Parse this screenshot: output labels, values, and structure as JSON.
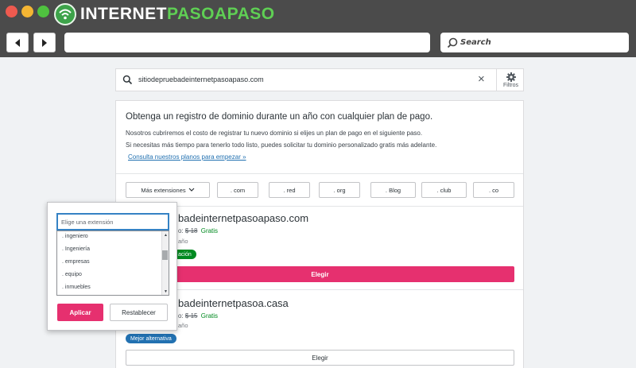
{
  "brand": {
    "logo_white": "INTERNET",
    "logo_green": "PASOAPASO"
  },
  "browser": {
    "search_placeholder": "Search",
    "colors": {
      "chrome": "#4b4b4b",
      "close": "#ee5a4f",
      "minimize": "#f4b533",
      "maximize": "#4fc23f"
    }
  },
  "search": {
    "query": "sitiodepruebadeinternetpasoapaso.com",
    "filters_label": "Filtros"
  },
  "promo": {
    "title": "Obtenga un registro de dominio durante un año con cualquier plan de pago.",
    "line1": "Nosotros cubriremos el costo de registrar tu nuevo dominio si elijes un plan de pago en el siguiente paso.",
    "line2": "Si necesitas más tiempo para tenerlo todo listo, puedes solicitar tu dominio personalizado gratis más adelante.",
    "link": "Consulta nuestros planos para empezar »"
  },
  "extensions": {
    "more_label": "Más extensiones",
    "tlds": [
      ". com",
      ". red",
      ". org",
      ". Blog",
      ". club",
      ". co"
    ]
  },
  "results": [
    {
      "name": "sitiodepruebadeinternetpasoapaso.com",
      "visible_name": "badeinternetpasoapaso.com",
      "price_prefix": "o:",
      "old_price": "$ 18",
      "free": "Gratis",
      "term": "año",
      "badge": "ación",
      "choose": "Elegir"
    },
    {
      "name": "sitiodepruebadeinternetpasoa.casa",
      "visible_name": "badeinternetpasoa.casa",
      "price_prefix": "o:",
      "old_price": "$ 15",
      "free": "Gratis",
      "term": "año",
      "badge": "Mejor alternativa",
      "choose": "Elegir"
    }
  ],
  "popover": {
    "placeholder": "Elige una extensión",
    "items": [
      ". ingeniero",
      ". Ingeniería",
      ". empresas",
      ". equipo",
      ". inmuebles"
    ],
    "apply": "Aplicar",
    "reset": "Restablecer"
  },
  "colors": {
    "accent": "#e6306f",
    "link": "#2271b1",
    "success": "#008a20",
    "focus": "#3582c4"
  }
}
